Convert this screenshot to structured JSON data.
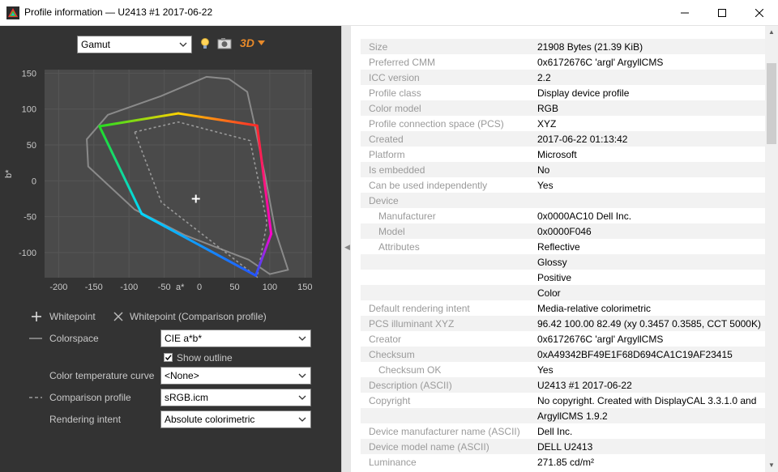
{
  "window": {
    "title": "Profile information — U2413 #1 2017-06-22"
  },
  "toolbar": {
    "view_select": "Gamut",
    "three_d_label": "3D"
  },
  "chart_data": {
    "type": "scatter",
    "xlabel": "a*",
    "ylabel": "b*",
    "xlim": [
      -220,
      160
    ],
    "ylim": [
      -135,
      155
    ],
    "x_ticks": [
      "-200",
      "-150",
      "-100",
      "-50",
      "0",
      "50",
      "100",
      "150"
    ],
    "y_ticks": [
      "150",
      "100",
      "50",
      "0",
      "-50",
      "-100"
    ],
    "whitepoint": [
      -5,
      -25
    ],
    "profile_gamut": [
      [
        -142,
        76
      ],
      [
        -30,
        94
      ],
      [
        82,
        77
      ],
      [
        102,
        -74
      ],
      [
        80,
        -132
      ],
      [
        -82,
        -46
      ]
    ],
    "comparison_gamut": [
      [
        -92,
        68
      ],
      [
        -30,
        82
      ],
      [
        72,
        56
      ],
      [
        96,
        -58
      ],
      [
        82,
        -134
      ],
      [
        -54,
        -30
      ]
    ],
    "outline": [
      [
        -160,
        58
      ],
      [
        -130,
        92
      ],
      [
        -55,
        118
      ],
      [
        10,
        145
      ],
      [
        42,
        142
      ],
      [
        68,
        124
      ],
      [
        78,
        80
      ],
      [
        94,
        4
      ],
      [
        108,
        -70
      ],
      [
        126,
        -124
      ],
      [
        100,
        -130
      ],
      [
        70,
        -110
      ],
      [
        -20,
        -76
      ],
      [
        -92,
        -40
      ],
      [
        -158,
        20
      ]
    ],
    "grid": true
  },
  "legend": {
    "whitepoint": "Whitepoint",
    "whitepoint_comparison": "Whitepoint (Comparison profile)"
  },
  "controls": {
    "colorspace_label": "Colorspace",
    "colorspace_value": "CIE a*b*",
    "show_outline_label": "Show outline",
    "temp_curve_label": "Color temperature curve",
    "temp_curve_value": "<None>",
    "comparison_label": "Comparison profile",
    "comparison_value": "sRGB.icm",
    "intent_label": "Rendering intent",
    "intent_value": "Absolute colorimetric"
  },
  "info_rows": [
    {
      "key": "Size",
      "value": "21908 Bytes (21.39 KiB)",
      "indent": 0
    },
    {
      "key": "Preferred CMM",
      "value": "0x6172676C 'argl' ArgyllCMS",
      "indent": 0
    },
    {
      "key": "ICC version",
      "value": "2.2",
      "indent": 0
    },
    {
      "key": "Profile class",
      "value": "Display device profile",
      "indent": 0
    },
    {
      "key": "Color model",
      "value": "RGB",
      "indent": 0
    },
    {
      "key": "Profile connection space (PCS)",
      "value": "XYZ",
      "indent": 0
    },
    {
      "key": "Created",
      "value": "2017-06-22 01:13:42",
      "indent": 0
    },
    {
      "key": "Platform",
      "value": "Microsoft",
      "indent": 0
    },
    {
      "key": "Is embedded",
      "value": "No",
      "indent": 0
    },
    {
      "key": "Can be used independently",
      "value": "Yes",
      "indent": 0
    },
    {
      "key": "Device",
      "value": "",
      "indent": 0
    },
    {
      "key": "Manufacturer",
      "value": "0x0000AC10 Dell Inc.",
      "indent": 1
    },
    {
      "key": "Model",
      "value": "0x0000F046",
      "indent": 1
    },
    {
      "key": "Attributes",
      "value": "Reflective",
      "indent": 1
    },
    {
      "key": "",
      "value": "Glossy",
      "indent": 0
    },
    {
      "key": "",
      "value": "Positive",
      "indent": 0
    },
    {
      "key": "",
      "value": "Color",
      "indent": 0
    },
    {
      "key": "Default rendering intent",
      "value": "Media-relative colorimetric",
      "indent": 0
    },
    {
      "key": "PCS illuminant XYZ",
      "value": "96.42 100.00  82.49 (xy 0.3457 0.3585, CCT 5000K)",
      "indent": 0
    },
    {
      "key": "Creator",
      "value": "0x6172676C 'argl' ArgyllCMS",
      "indent": 0
    },
    {
      "key": "Checksum",
      "value": "0xA49342BF49E1F68D694CA1C19AF23415",
      "indent": 0
    },
    {
      "key": "Checksum OK",
      "value": "Yes",
      "indent": 1
    },
    {
      "key": "Description (ASCII)",
      "value": "U2413 #1 2017-06-22",
      "indent": 0
    },
    {
      "key": "Copyright",
      "value": "No copyright. Created with DisplayCAL 3.3.1.0 and",
      "indent": 0
    },
    {
      "key": "",
      "value": "ArgyllCMS 1.9.2",
      "indent": 0
    },
    {
      "key": "Device manufacturer name (ASCII)",
      "value": "Dell Inc.",
      "indent": 0
    },
    {
      "key": "Device model name (ASCII)",
      "value": "DELL U2413",
      "indent": 0
    },
    {
      "key": "Luminance",
      "value": "271.85 cd/m²",
      "indent": 0
    }
  ]
}
